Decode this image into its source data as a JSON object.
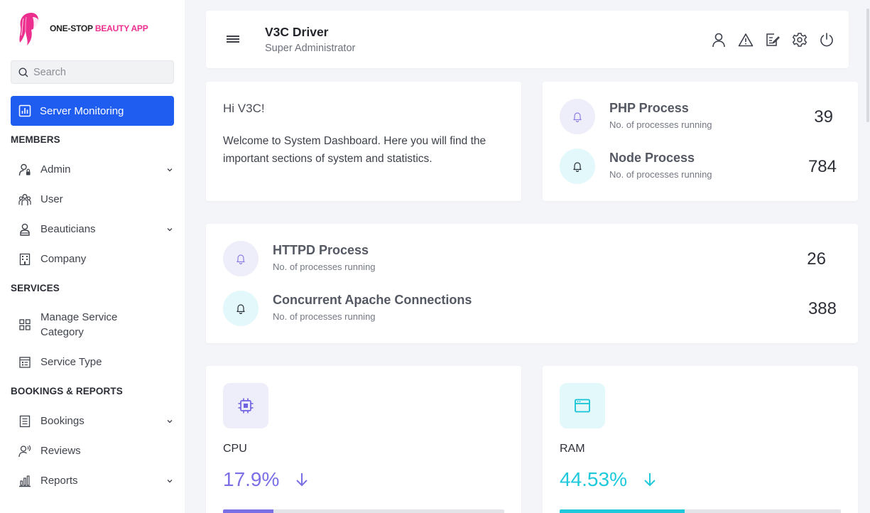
{
  "brand": {
    "name_part1": "ONE-STOP",
    "name_part2": "BEAUTY APP",
    "accent": "#ec2f8e"
  },
  "sidebar": {
    "search_placeholder": "Search",
    "active_item": {
      "label": "Server Monitoring",
      "icon": "bar-chart-icon"
    },
    "sections": [
      {
        "title": "MEMBERS",
        "items": [
          {
            "label": "Admin",
            "icon": "admin-user-icon",
            "expandable": true
          },
          {
            "label": "User",
            "icon": "users-group-icon",
            "expandable": false
          },
          {
            "label": "Beauticians",
            "icon": "beautician-icon",
            "expandable": true
          },
          {
            "label": "Company",
            "icon": "building-icon",
            "expandable": false
          }
        ]
      },
      {
        "title": "SERVICES",
        "items": [
          {
            "label": "Manage Service Category",
            "icon": "grid-icon",
            "expandable": false
          },
          {
            "label": "Service Type",
            "icon": "service-type-icon",
            "expandable": false
          }
        ]
      },
      {
        "title": "BOOKINGS & REPORTS",
        "items": [
          {
            "label": "Bookings",
            "icon": "document-icon",
            "expandable": true
          },
          {
            "label": "Reviews",
            "icon": "review-icon",
            "expandable": false
          },
          {
            "label": "Reports",
            "icon": "reports-chart-icon",
            "expandable": true
          }
        ]
      }
    ]
  },
  "header": {
    "title": "V3C Driver",
    "subtitle": "Super Administrator",
    "icons": [
      "profile-icon",
      "alert-icon",
      "edit-icon",
      "settings-icon",
      "power-icon"
    ]
  },
  "welcome": {
    "greeting": "Hi V3C!",
    "text": "Welcome to System Dashboard. Here you will find the important sections of system and statistics."
  },
  "processes": [
    {
      "name": "PHP Process",
      "desc": "No. of processes running",
      "value": "39"
    },
    {
      "name": "Node Process",
      "desc": "No. of processes running",
      "value": "784"
    },
    {
      "name": "HTTPD Process",
      "desc": "No. of processes running",
      "value": "26"
    },
    {
      "name": "Concurrent Apache Connections",
      "desc": "No. of processes running",
      "value": "388"
    }
  ],
  "stats": [
    {
      "name": "CPU",
      "value": "17.9%",
      "progress_fraction": 0.179,
      "color": "#7b6fe6",
      "icon": "cpu-icon",
      "trend": "down"
    },
    {
      "name": "RAM",
      "value": "44.53%",
      "progress_fraction": 0.4453,
      "color": "#1fc9dc",
      "icon": "ram-window-icon",
      "trend": "down"
    }
  ]
}
